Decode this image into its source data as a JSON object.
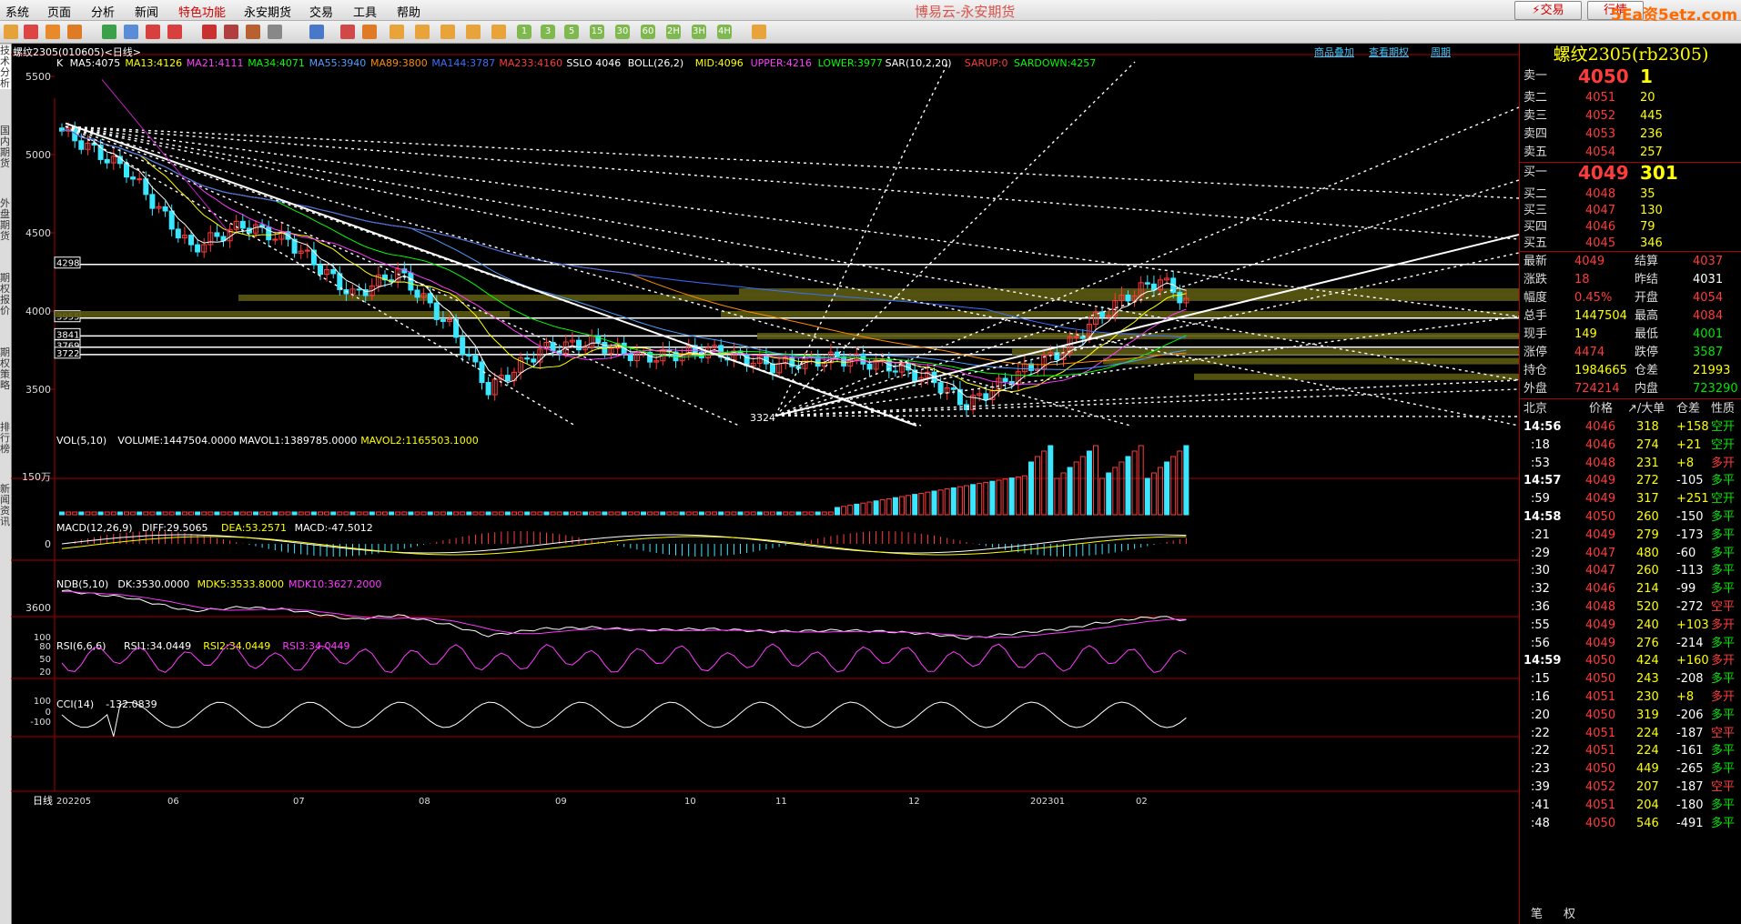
{
  "menu": {
    "items": [
      "系统",
      "页面",
      "分析",
      "新闻",
      "特色功能",
      "永安期货",
      "交易",
      "工具",
      "帮助"
    ],
    "title": "博易云-永安期货",
    "trade_button": "交易",
    "quote_button": "行情",
    "watermark": "5Ea资5etz.com"
  },
  "left_tabs": [
    "技术分析",
    "国内期货",
    "外盘期货",
    "期权报价",
    "期权策略",
    "排行榜",
    "新闻资讯"
  ],
  "chart": {
    "title": "螺纹2305(010605)<日线>",
    "links": [
      "商品叠加",
      "查看期权",
      "周期"
    ],
    "ma_labels": [
      {
        "text": "K",
        "color": "#ffffff"
      },
      {
        "text": "MA5:4075",
        "color": "#ffffff"
      },
      {
        "text": "MA13:4126",
        "color": "#ffff00"
      },
      {
        "text": "MA21:4111",
        "color": "#ff3bff"
      },
      {
        "text": "MA34:4071",
        "color": "#00ff00"
      },
      {
        "text": "MA55:3940",
        "color": "#4f9dff"
      },
      {
        "text": "MA89:3800",
        "color": "#ff8a00"
      },
      {
        "text": "MA144:3787",
        "color": "#3a70ff"
      },
      {
        "text": "MA233:4160",
        "color": "#ff3b3b"
      },
      {
        "text": "SSLO 4046",
        "color": "#ffffff"
      },
      {
        "text": "BOLL(26,2)",
        "color": "#ffffff"
      },
      {
        "text": "MID:4096",
        "color": "#ffff00"
      },
      {
        "text": "UPPER:4216",
        "color": "#ff3bff"
      },
      {
        "text": "LOWER:3977",
        "color": "#00ff00"
      },
      {
        "text": "SAR(10,2,20)",
        "color": "#ffffff"
      },
      {
        "text": "SARUP:0",
        "color": "#ff3b3b"
      },
      {
        "text": "SARDOWN:4257",
        "color": "#00ff00"
      }
    ],
    "price_ticks": [
      "5500",
      "5000",
      "4500",
      "4000",
      "3500"
    ],
    "boxed_levels": [
      "4298",
      "3955",
      "3841",
      "3769",
      "3722"
    ],
    "low_label": "3324",
    "vol_labels": [
      {
        "text": "VOL(5,10)",
        "color": "#ffffff"
      },
      {
        "text": "VOLUME:1447504.0000",
        "color": "#ffffff"
      },
      {
        "text": "MAVOL1:1389785.0000",
        "color": "#ffffff"
      },
      {
        "text": "MAVOL2:1165503.1000",
        "color": "#ffff00"
      }
    ],
    "vol_tick": "150万",
    "macd_labels": [
      {
        "text": "MACD(12,26,9)",
        "color": "#ffffff"
      },
      {
        "text": "DIFF:29.5065",
        "color": "#ffffff"
      },
      {
        "text": "DEA:53.2571",
        "color": "#ffff00"
      },
      {
        "text": "MACD:-47.5012",
        "color": "#ffffff"
      }
    ],
    "macd_tick": "0",
    "ndb_labels": [
      {
        "text": "NDB(5,10)",
        "color": "#ffffff"
      },
      {
        "text": "DK:3530.0000",
        "color": "#ffffff"
      },
      {
        "text": "MDK5:3533.8000",
        "color": "#ffff00"
      },
      {
        "text": "MDK10:3627.2000",
        "color": "#ff3bff"
      }
    ],
    "ndb_tick": "3600",
    "rsi_labels": [
      {
        "text": "RSI(6,6,6)",
        "color": "#ffffff"
      },
      {
        "text": "RSI1:34.0449",
        "color": "#ffffff"
      },
      {
        "text": "RSI2:34.0449",
        "color": "#ffff00"
      },
      {
        "text": "RSI3:34.0449",
        "color": "#ff3bff"
      }
    ],
    "rsi_ticks": [
      "100",
      "80",
      "50",
      "20"
    ],
    "cci_labels": [
      {
        "text": "CCI(14)",
        "color": "#ffffff"
      },
      {
        "text": "-132.0839",
        "color": "#ffffff"
      }
    ],
    "cci_ticks": [
      "100",
      "0",
      "-100"
    ],
    "period_label": "日线",
    "date_ticks": [
      "202205",
      "06",
      "07",
      "08",
      "09",
      "10",
      "11",
      "12",
      "202301",
      "02"
    ]
  },
  "quote": {
    "title": "螺纹2305(rb2305)",
    "asks": [
      {
        "label": "卖五",
        "price": "4054",
        "vol": "257"
      },
      {
        "label": "卖四",
        "price": "4053",
        "vol": "236"
      },
      {
        "label": "卖三",
        "price": "4052",
        "vol": "445"
      },
      {
        "label": "卖二",
        "price": "4051",
        "vol": "20"
      },
      {
        "label": "卖一",
        "price": "4050",
        "vol": "1"
      }
    ],
    "bids": [
      {
        "label": "买一",
        "price": "4049",
        "vol": "301"
      },
      {
        "label": "买二",
        "price": "4048",
        "vol": "35"
      },
      {
        "label": "买三",
        "price": "4047",
        "vol": "130"
      },
      {
        "label": "买四",
        "price": "4046",
        "vol": "79"
      },
      {
        "label": "买五",
        "price": "4045",
        "vol": "346"
      }
    ],
    "stats": [
      {
        "l1": "最新",
        "v1": "4049",
        "c1": "red",
        "l2": "结算",
        "v2": "4037",
        "c2": "red"
      },
      {
        "l1": "涨跌",
        "v1": "18",
        "c1": "red",
        "l2": "昨结",
        "v2": "4031",
        "c2": "wht"
      },
      {
        "l1": "幅度",
        "v1": "0.45%",
        "c1": "red",
        "l2": "开盘",
        "v2": "4054",
        "c2": "red"
      },
      {
        "l1": "总手",
        "v1": "1447504",
        "c1": "yel",
        "l2": "最高",
        "v2": "4084",
        "c2": "red"
      },
      {
        "l1": "现手",
        "v1": "149",
        "c1": "yel",
        "l2": "最低",
        "v2": "4001",
        "c2": "grn"
      },
      {
        "l1": "涨停",
        "v1": "4474",
        "c1": "red",
        "l2": "跌停",
        "v2": "3587",
        "c2": "grn"
      },
      {
        "l1": "持仓",
        "v1": "1984665",
        "c1": "yel",
        "l2": "仓差",
        "v2": "21993",
        "c2": "yel"
      },
      {
        "l1": "外盘",
        "v1": "724214",
        "c1": "red",
        "l2": "内盘",
        "v2": "723290",
        "c2": "grn"
      }
    ],
    "tick_header": [
      "北京",
      "价格",
      "↗/大单",
      "仓差",
      "性质"
    ],
    "ticks": [
      {
        "t": "14:56",
        "p": "4046",
        "v": "318",
        "d": "+158",
        "n": "空开",
        "bold": true
      },
      {
        "t": ":18",
        "p": "4046",
        "v": "274",
        "d": "+21",
        "n": "空开",
        "bold": false
      },
      {
        "t": ":53",
        "p": "4048",
        "v": "231",
        "d": "+8",
        "n": "多开",
        "bold": false
      },
      {
        "t": "14:57",
        "p": "4049",
        "v": "272",
        "d": "-105",
        "n": "多平",
        "bold": true
      },
      {
        "t": ":59",
        "p": "4049",
        "v": "317",
        "d": "+251",
        "n": "空开",
        "bold": false
      },
      {
        "t": "14:58",
        "p": "4050",
        "v": "260",
        "d": "-150",
        "n": "多平",
        "bold": true
      },
      {
        "t": ":21",
        "p": "4049",
        "v": "279",
        "d": "-173",
        "n": "多平",
        "bold": false
      },
      {
        "t": ":29",
        "p": "4047",
        "v": "480",
        "d": "-60",
        "n": "多平",
        "bold": false
      },
      {
        "t": ":30",
        "p": "4047",
        "v": "260",
        "d": "-113",
        "n": "多平",
        "bold": false
      },
      {
        "t": ":32",
        "p": "4046",
        "v": "214",
        "d": "-99",
        "n": "多平",
        "bold": false
      },
      {
        "t": ":36",
        "p": "4048",
        "v": "520",
        "d": "-272",
        "n": "空平",
        "bold": false
      },
      {
        "t": ":55",
        "p": "4049",
        "v": "240",
        "d": "+103",
        "n": "多开",
        "bold": false
      },
      {
        "t": ":56",
        "p": "4049",
        "v": "276",
        "d": "-214",
        "n": "多平",
        "bold": false
      },
      {
        "t": "14:59",
        "p": "4050",
        "v": "424",
        "d": "+160",
        "n": "多开",
        "bold": true
      },
      {
        "t": ":15",
        "p": "4050",
        "v": "243",
        "d": "-208",
        "n": "多平",
        "bold": false
      },
      {
        "t": ":16",
        "p": "4051",
        "v": "230",
        "d": "+8",
        "n": "多开",
        "bold": false
      },
      {
        "t": ":20",
        "p": "4050",
        "v": "319",
        "d": "-206",
        "n": "多平",
        "bold": false
      },
      {
        "t": ":22",
        "p": "4051",
        "v": "224",
        "d": "-187",
        "n": "空平",
        "bold": false
      },
      {
        "t": ":22",
        "p": "4051",
        "v": "224",
        "d": "-161",
        "n": "多平",
        "bold": false
      },
      {
        "t": ":23",
        "p": "4050",
        "v": "449",
        "d": "-265",
        "n": "多平",
        "bold": false
      },
      {
        "t": ":39",
        "p": "4052",
        "v": "207",
        "d": "-187",
        "n": "空平",
        "bold": false
      },
      {
        "t": ":41",
        "p": "4051",
        "v": "204",
        "d": "-180",
        "n": "多平",
        "bold": false
      },
      {
        "t": ":48",
        "p": "4050",
        "v": "546",
        "d": "-491",
        "n": "多平",
        "bold": false
      }
    ],
    "bottom_tabs": [
      "笔",
      "权"
    ]
  }
}
